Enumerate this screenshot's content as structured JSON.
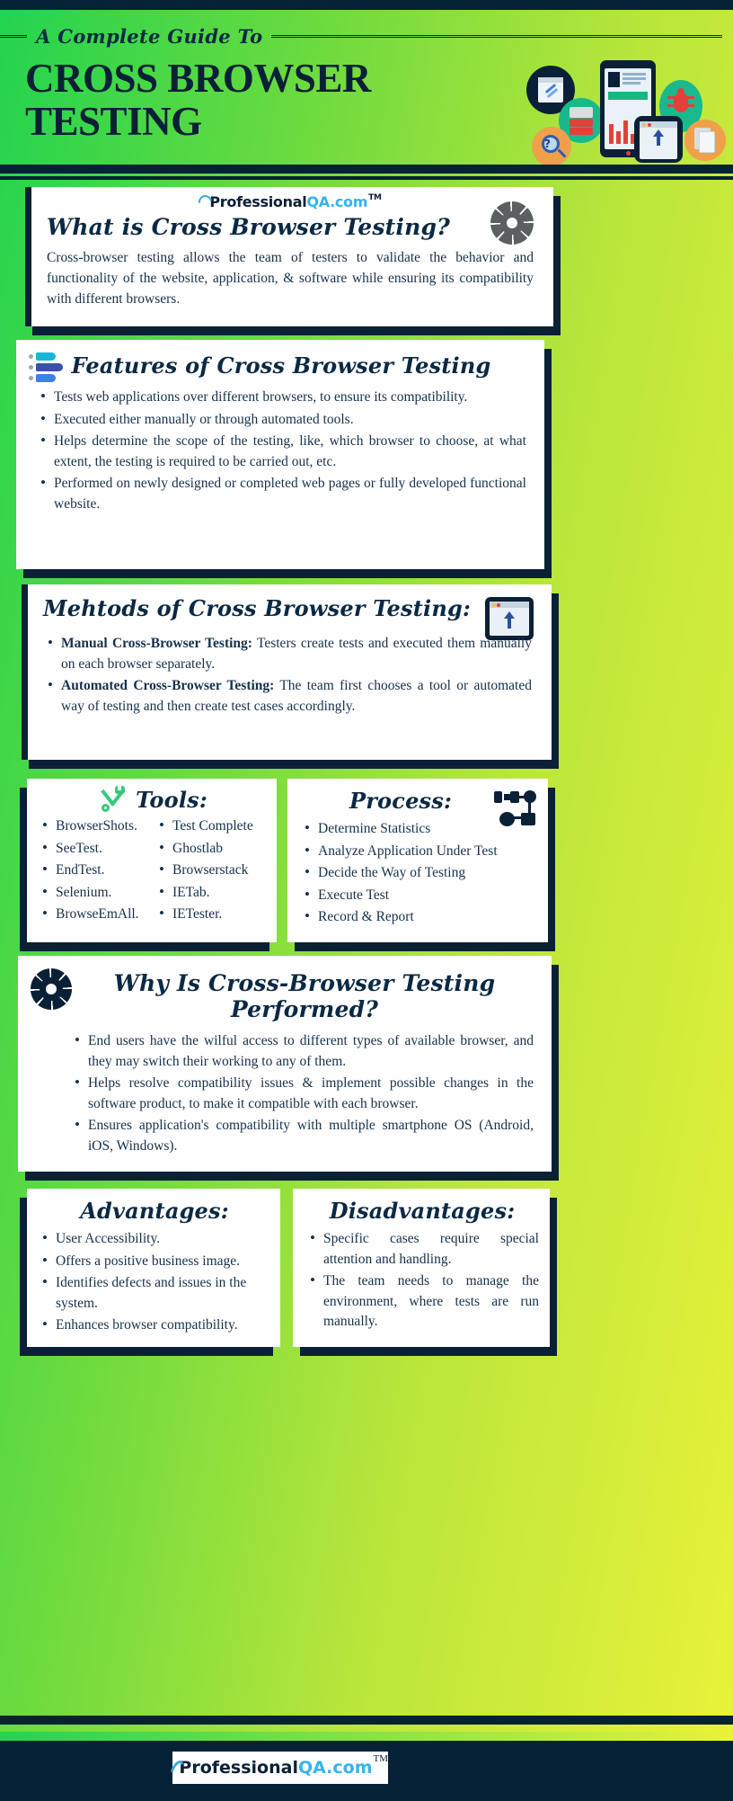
{
  "brand": {
    "name_dark": "Professional",
    "name_blue": "QA.com",
    "tm": "TM"
  },
  "header": {
    "kicker": "A Complete Guide To",
    "title_line1": "CROSS BROWSER",
    "title_line2": "TESTING",
    "icons": [
      "link-browser-icon",
      "server-rack-icon",
      "magnifier-question-icon",
      "mobile-dashboard-icon",
      "bug-icon",
      "upload-browser-icon",
      "documents-icon"
    ]
  },
  "what_is": {
    "heading": "What is Cross Browser Testing?",
    "paragraph": "Cross-browser testing allows the team of testers to validate the behavior and functionality of the website, application, & software while ensuring its compatibility with different browsers.",
    "icon": "gear-icon"
  },
  "features": {
    "heading": "Features of Cross Browser Testing",
    "icon": "list-bars-icon",
    "items": [
      "Tests web applications over different browsers, to ensure its compatibility.",
      "Executed either manually or through automated tools.",
      "Helps determine the scope of the testing, like, which browser to choose, at what extent, the testing is required to be carried out, etc.",
      "Performed on newly designed or completed web pages or fully developed functional website."
    ]
  },
  "methods": {
    "heading": "Mehtods of Cross Browser Testing:",
    "icon": "browser-upload-icon",
    "items": [
      {
        "label": "Manual Cross-Browser Testing:",
        "text": " Testers create tests and executed them manually on each browser separately."
      },
      {
        "label": "Automated Cross-Browser Testing:",
        "text": " The team first chooses a tool or automated way of testing and then create test cases accordingly."
      }
    ]
  },
  "tools": {
    "heading": "Tools:",
    "icon": "wrench-screwdriver-icon",
    "column_left": [
      "BrowserShots.",
      "SeeTest.",
      "EndTest.",
      "Selenium.",
      "BrowseEmAll."
    ],
    "column_right": [
      "Test Complete",
      "Ghostlab",
      "Browserstack",
      "IETab.",
      "IETester."
    ]
  },
  "process": {
    "heading": "Process:",
    "icon": "node-flowchart-icon",
    "items": [
      "Determine Statistics",
      "Analyze Application Under Test",
      "Decide the Way of Testing",
      "Execute Test",
      "Record & Report"
    ]
  },
  "why": {
    "heading": "Why Is Cross-Browser Testing Performed?",
    "icon": "gear-icon",
    "items": [
      "End users have the wilful access to different types of available browser, and they may switch their working to any of them.",
      "Helps resolve compatibility issues & implement possible changes in the software product, to make it compatible with each browser.",
      "Ensures application's compatibility with multiple smartphone OS (Android, iOS, Windows)."
    ]
  },
  "advantages": {
    "heading": "Advantages:",
    "items": [
      "User Accessibility.",
      "Offers a positive business image.",
      "Identifies defects and issues in the system.",
      "Enhances browser compatibility."
    ]
  },
  "disadvantages": {
    "heading": "Disadvantages:",
    "items": [
      "Specific cases require special attention and handling.",
      "The team needs to manage the environment, where tests are run manually."
    ]
  },
  "colors": {
    "navy": "#0a2036",
    "green_start": "#22d44f",
    "yellow_end": "#eaf23a",
    "logo_blue": "#35b4ea",
    "tools_icon_green": "#35c97a"
  }
}
